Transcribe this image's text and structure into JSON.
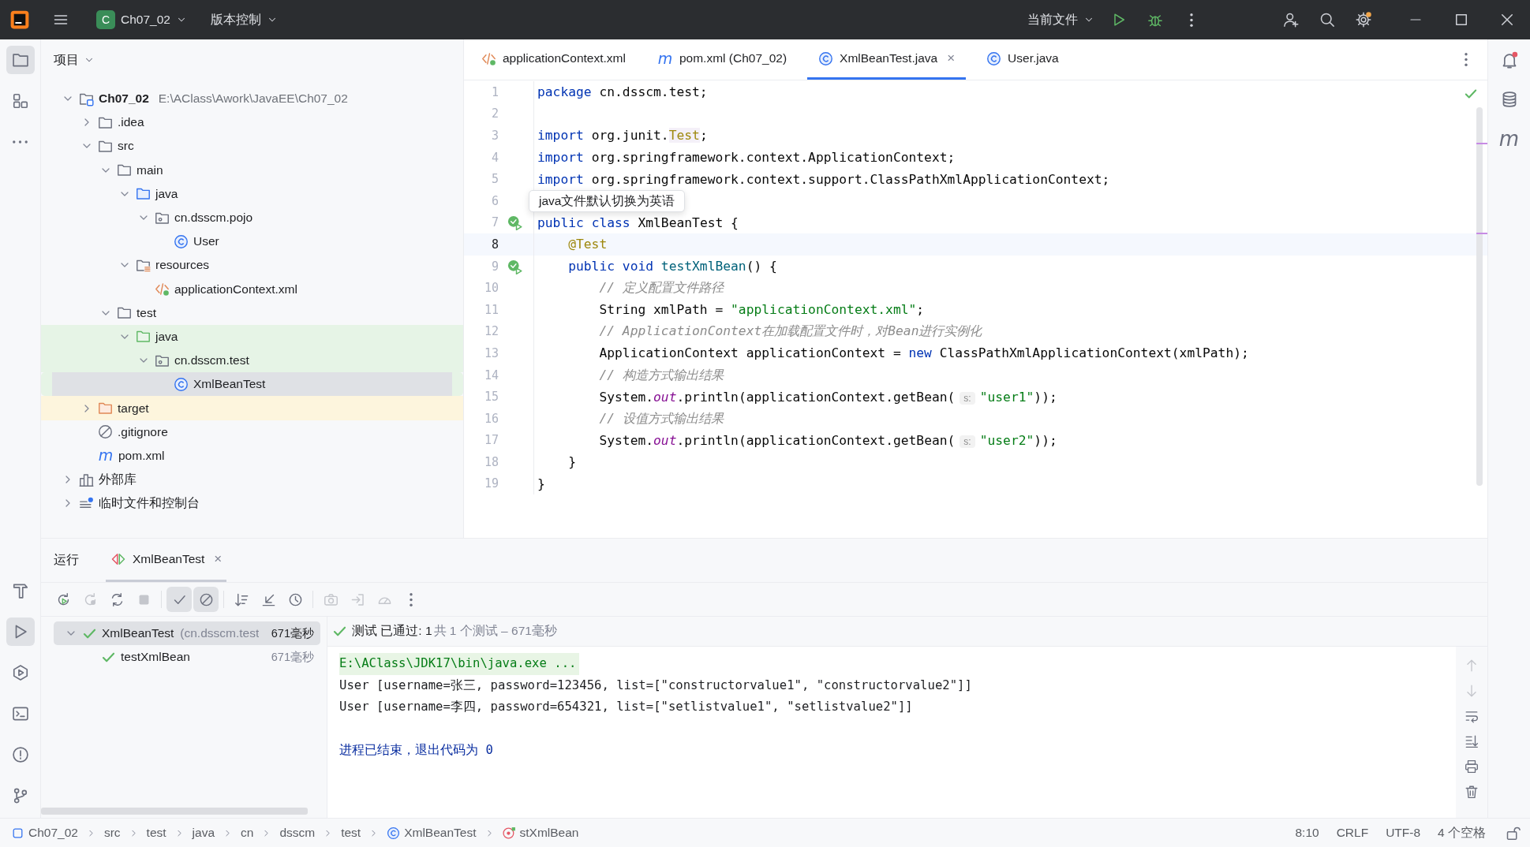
{
  "title_bar": {
    "project": {
      "badge": "C",
      "name": "Ch07_02"
    },
    "vcs_menu": "版本控制",
    "run_config": "当前文件"
  },
  "left_tools": [
    {
      "kind": "folder",
      "selected": true
    },
    {
      "kind": "structure",
      "selected": false
    },
    {
      "kind": "more",
      "selected": false
    }
  ],
  "left_tools_bottom": [
    {
      "kind": "build",
      "selected": false
    },
    {
      "kind": "run",
      "selected": true
    },
    {
      "kind": "services",
      "selected": false
    },
    {
      "kind": "terminal",
      "selected": false
    },
    {
      "kind": "problems",
      "selected": false
    },
    {
      "kind": "git",
      "selected": false
    }
  ],
  "right_tools": [
    {
      "kind": "notifications"
    },
    {
      "kind": "database"
    },
    {
      "kind": "maven",
      "glyph": "m"
    }
  ],
  "project": {
    "title": "项目",
    "tree": [
      {
        "label": "Ch07_02",
        "path": "E:\\AClass\\Awork\\JavaEE\\Ch07_02",
        "kind": "module",
        "expanded": true,
        "selected": false,
        "children": [
          {
            "label": ".idea",
            "kind": "folder",
            "expanded": false,
            "selected": false
          },
          {
            "label": "src",
            "kind": "folder",
            "expanded": true,
            "selected": false,
            "children": [
              {
                "label": "main",
                "kind": "folder",
                "expanded": true,
                "selected": false,
                "children": [
                  {
                    "label": "java",
                    "kind": "src-folder",
                    "expanded": true,
                    "selected": false,
                    "children": [
                      {
                        "label": "cn.dsscm.pojo",
                        "kind": "package",
                        "expanded": true,
                        "selected": false,
                        "children": [
                          {
                            "label": "User",
                            "kind": "class",
                            "selected": false
                          }
                        ]
                      }
                    ]
                  },
                  {
                    "label": "resources",
                    "kind": "resources",
                    "expanded": true,
                    "selected": false,
                    "children": [
                      {
                        "label": "applicationContext.xml",
                        "kind": "xml",
                        "selected": false
                      }
                    ]
                  }
                ]
              },
              {
                "label": "test",
                "kind": "folder",
                "expanded": true,
                "selected": false,
                "children": [
                  {
                    "label": "java",
                    "kind": "test-folder",
                    "test_source": true,
                    "expanded": true,
                    "selected": false,
                    "children": [
                      {
                        "label": "cn.dsscm.test",
                        "kind": "package",
                        "test_source": true,
                        "expanded": true,
                        "selected": false,
                        "children": [
                          {
                            "label": "XmlBeanTest",
                            "kind": "class",
                            "test_source": true,
                            "selected": true
                          }
                        ]
                      }
                    ]
                  }
                ]
              }
            ]
          },
          {
            "label": "target",
            "kind": "excluded-folder",
            "excluded": true,
            "expanded": false,
            "selected": false
          },
          {
            "label": ".gitignore",
            "kind": "ignore",
            "selected": false
          },
          {
            "label": "pom.xml",
            "kind": "maven",
            "glyph": "m",
            "selected": false
          }
        ]
      },
      {
        "label": "外部库",
        "kind": "library",
        "expanded": false,
        "selected": false
      },
      {
        "label": "临时文件和控制台",
        "kind": "scratch",
        "expanded": false,
        "selected": false
      }
    ]
  },
  "editor": {
    "tabs": [
      {
        "label": "applicationContext.xml",
        "kind": "xml",
        "selected": false
      },
      {
        "label": "pom.xml (Ch07_02)",
        "kind": "maven",
        "glyph": "m",
        "selected": false
      },
      {
        "label": "XmlBeanTest.java",
        "kind": "class",
        "selected": true,
        "close": "×"
      },
      {
        "label": "User.java",
        "kind": "class",
        "selected": false
      }
    ],
    "lines": [
      {
        "n": "1",
        "tokens": [
          {
            "kind": "kw",
            "text": "package"
          },
          {
            "kind": "plain",
            "text": " cn.dsscm.test;"
          }
        ]
      },
      {
        "n": "2"
      },
      {
        "n": "3",
        "tokens": [
          {
            "kind": "kw",
            "text": "import"
          },
          {
            "kind": "plain",
            "text": " org.junit."
          },
          {
            "kind": "typeref",
            "text": "Test"
          },
          {
            "kind": "plain",
            "text": ";"
          }
        ]
      },
      {
        "n": "4",
        "tokens": [
          {
            "kind": "kw",
            "text": "import"
          },
          {
            "kind": "plain",
            "text": " org.springframework.context.ApplicationContext;"
          }
        ]
      },
      {
        "n": "5",
        "tokens": [
          {
            "kind": "kw",
            "text": "import"
          },
          {
            "kind": "plain",
            "text": " org.springframework.context.support.ClassPathXmlApplicationContext;"
          }
        ]
      },
      {
        "n": "6"
      },
      {
        "n": "7",
        "run": true,
        "tokens": [
          {
            "kind": "kw",
            "text": "public"
          },
          {
            "kind": "kw",
            "text": " class"
          },
          {
            "kind": "plain",
            "text": " XmlBeanTest {"
          }
        ]
      },
      {
        "n": "8",
        "current": true,
        "tokens": [
          {
            "kind": "annot",
            "text": "    @Test"
          }
        ]
      },
      {
        "n": "9",
        "run": true,
        "tokens": [
          {
            "kind": "kw",
            "text": "    public"
          },
          {
            "kind": "kw",
            "text": " void"
          },
          {
            "kind": "decl",
            "text": " testXmlBean"
          },
          {
            "kind": "plain",
            "text": "() {"
          }
        ]
      },
      {
        "n": "10",
        "tokens": [
          {
            "kind": "comment",
            "text": "        // 定义配置文件路径"
          }
        ]
      },
      {
        "n": "11",
        "tokens": [
          {
            "kind": "plain",
            "text": "        String xmlPath = "
          },
          {
            "kind": "str",
            "text": "\"applicationContext.xml\""
          },
          {
            "kind": "plain",
            "text": ";"
          }
        ]
      },
      {
        "n": "12",
        "tokens": [
          {
            "kind": "comment",
            "text": "        // ApplicationContext在加载配置文件时，对Bean进行实例化"
          }
        ]
      },
      {
        "n": "13",
        "tokens": [
          {
            "kind": "plain",
            "text": "        ApplicationContext applicationContext = "
          },
          {
            "kind": "kw",
            "text": "new"
          },
          {
            "kind": "plain",
            "text": " ClassPathXmlApplicationContext(xmlPath);"
          }
        ]
      },
      {
        "n": "14",
        "tokens": [
          {
            "kind": "comment",
            "text": "        // 构造方式输出结果"
          }
        ]
      },
      {
        "n": "15",
        "tokens": [
          {
            "kind": "plain",
            "text": "        System."
          },
          {
            "kind": "field",
            "text": "out"
          },
          {
            "kind": "plain",
            "text": ".println(applicationContext.getBean("
          },
          {
            "kind": "hint",
            "text": "s:"
          },
          {
            "kind": "str",
            "text": "\"user1\""
          },
          {
            "kind": "plain",
            "text": "));"
          }
        ]
      },
      {
        "n": "16",
        "tokens": [
          {
            "kind": "comment",
            "text": "        // 设值方式输出结果"
          }
        ]
      },
      {
        "n": "17",
        "tokens": [
          {
            "kind": "plain",
            "text": "        System."
          },
          {
            "kind": "field",
            "text": "out"
          },
          {
            "kind": "plain",
            "text": ".println(applicationContext.getBean("
          },
          {
            "kind": "hint",
            "text": "s:"
          },
          {
            "kind": "str",
            "text": "\"user2\""
          },
          {
            "kind": "plain",
            "text": "));"
          }
        ]
      },
      {
        "n": "18",
        "tokens": [
          {
            "kind": "plain",
            "text": "    }"
          }
        ]
      },
      {
        "n": "19",
        "tokens": [
          {
            "kind": "plain",
            "text": "}"
          }
        ]
      }
    ],
    "tooltip": "java文件默认切换为英语"
  },
  "run_panel": {
    "title": "运行",
    "tabs": [
      {
        "label": "XmlBeanTest",
        "selected": true,
        "close": "×"
      }
    ],
    "toolbar": [
      [
        {
          "kind": "rerun",
          "disabled": false,
          "on": false
        },
        {
          "kind": "rerun-failed",
          "disabled": true,
          "on": false
        },
        {
          "kind": "toggle-auto",
          "disabled": false,
          "on": false
        },
        {
          "kind": "stop",
          "disabled": true,
          "on": false
        }
      ],
      [
        {
          "kind": "show-passed",
          "disabled": false,
          "on": true
        },
        {
          "kind": "show-ignored",
          "disabled": false,
          "on": true
        }
      ],
      [
        {
          "kind": "sort",
          "disabled": false,
          "on": false
        },
        {
          "kind": "collapse",
          "disabled": false,
          "on": false
        },
        {
          "kind": "history",
          "disabled": false,
          "on": false
        }
      ],
      [
        {
          "kind": "camera",
          "disabled": true,
          "on": false
        },
        {
          "kind": "export",
          "disabled": true,
          "on": false
        },
        {
          "kind": "gauge",
          "disabled": true,
          "on": false
        },
        {
          "kind": "more",
          "disabled": false,
          "on": false
        }
      ]
    ],
    "tests": [
      {
        "label": "XmlBeanTest",
        "package": "(cn.dsscm.test",
        "time": "671毫秒",
        "passed": true,
        "expanded": true,
        "selected": true,
        "children": [
          {
            "label": "testXmlBean",
            "time": "671毫秒",
            "passed": true,
            "selected": false
          }
        ]
      }
    ],
    "summary": {
      "passed": true,
      "status": "测试 已通过: 1",
      "detail": "共 1 个测试 – 671毫秒"
    },
    "console": [
      {
        "kind": "command",
        "text": "E:\\AClass\\JDK17\\bin\\java.exe ..."
      },
      {
        "kind": "output",
        "text": "User [username=张三, password=123456, list=[\"constructorvalue1\", \"constructorvalue2\"]]"
      },
      {
        "kind": "output",
        "text": "User [username=李四, password=654321, list=[\"setlistvalue1\", \"setlistvalue2\"]]"
      },
      {
        "kind": "exit",
        "text": "进程已结束，退出代码为 0"
      }
    ],
    "console_tools": [
      {
        "kind": "up",
        "disabled": true
      },
      {
        "kind": "down",
        "disabled": true
      },
      {
        "kind": "wrap",
        "disabled": false
      },
      {
        "kind": "scroll-end",
        "disabled": false
      },
      {
        "kind": "print",
        "disabled": false
      },
      {
        "kind": "trash",
        "disabled": false
      }
    ]
  },
  "status_bar": {
    "breadcrumbs": [
      {
        "label": "Ch07_02",
        "kind": "module"
      },
      {
        "label": "src",
        "kind": "dir"
      },
      {
        "label": "test",
        "kind": "dir"
      },
      {
        "label": "java",
        "kind": "dir"
      },
      {
        "label": "cn",
        "kind": "dir"
      },
      {
        "label": "dsscm",
        "kind": "dir"
      },
      {
        "label": "test",
        "kind": "dir"
      },
      {
        "label": "XmlBeanTest",
        "kind": "class"
      },
      {
        "label": "stXmlBean",
        "kind": "method"
      }
    ],
    "items": [
      "8:10",
      "CRLF",
      "UTF-8",
      "4 个空格"
    ]
  }
}
